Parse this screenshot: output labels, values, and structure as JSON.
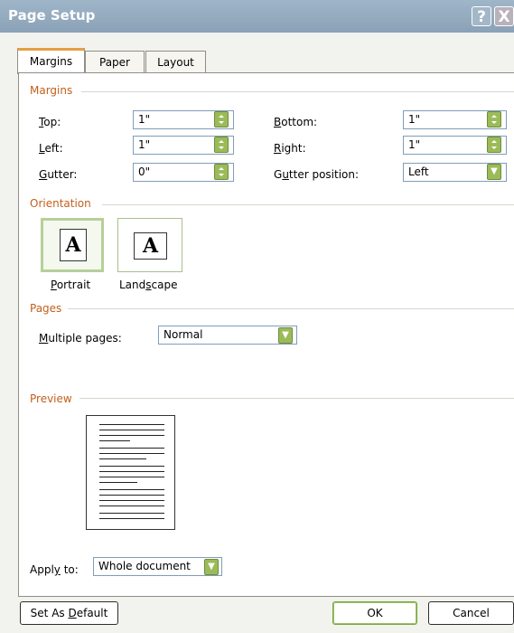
{
  "window": {
    "title": "Page Setup",
    "help_label": "?",
    "close_label": "X"
  },
  "tabs": {
    "margins": "Margins",
    "paper": "Paper",
    "layout": "Layout"
  },
  "sections": {
    "margins": "Margins",
    "orientation": "Orientation",
    "pages": "Pages",
    "preview": "Preview"
  },
  "fields": {
    "top": {
      "label_u": "T",
      "label_rest": "op:",
      "value": "1\""
    },
    "left": {
      "label_u": "L",
      "label_rest": "eft:",
      "value": "1\""
    },
    "gutter": {
      "label_u": "G",
      "label_rest": "utter:",
      "value": "0\""
    },
    "bottom": {
      "label_u": "B",
      "label_rest": "ottom:",
      "value": "1\""
    },
    "right": {
      "label_u": "R",
      "label_rest": "ight:",
      "value": "1\""
    },
    "gutter_position": {
      "label_pre": "G",
      "label_u": "u",
      "label_rest": "tter position:",
      "value": "Left"
    }
  },
  "orientation": {
    "icon_letter": "A",
    "portrait": {
      "label_u": "P",
      "label_rest": "ortrait"
    },
    "landscape": {
      "label_pre": "Land",
      "label_u": "s",
      "label_rest": "cape"
    }
  },
  "pages": {
    "label_u": "M",
    "label_rest": "ultiple pages:",
    "value": "Normal"
  },
  "apply_to": {
    "label_pre": "Appl",
    "label_u": "y",
    "label_rest": " to:",
    "value": "Whole document"
  },
  "buttons": {
    "set_default_pre": "Set As ",
    "set_default_u": "D",
    "set_default_rest": "efault",
    "ok": "OK",
    "cancel": "Cancel"
  },
  "colors": {
    "accent": "#c35f1c",
    "tab_highlight": "#e49f44",
    "control_green": "#9bbb59"
  }
}
